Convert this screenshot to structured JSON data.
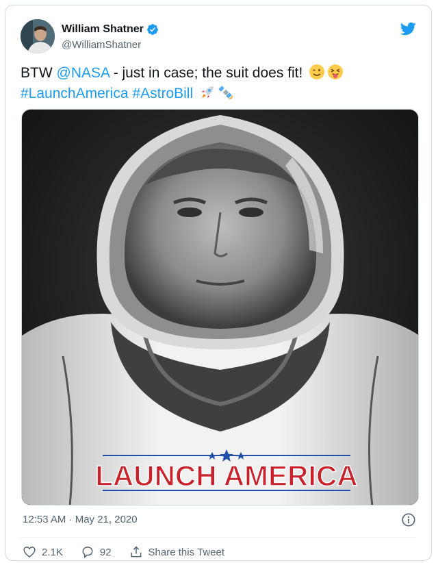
{
  "author": {
    "name": "William Shatner",
    "handle": "@WilliamShatner",
    "verified": true
  },
  "tweet": {
    "prefix": "BTW ",
    "mention": "@NASA",
    "body": " - just in case; the suit does fit!",
    "hashtag1": "#LaunchAmerica",
    "hashtag2": "#AstroBill",
    "emojis": [
      "wink-face-icon",
      "tongue-face-icon",
      "rocket-icon",
      "satellite-icon"
    ]
  },
  "media": {
    "banner_text": "LAUNCH AMERICA"
  },
  "meta": {
    "timestamp": "12:53 AM · May 21, 2020"
  },
  "actions": {
    "likes": "2.1K",
    "replies": "92",
    "share_label": "Share this Tweet"
  },
  "colors": {
    "link": "#1d9bf0",
    "verified": "#1d9bf0",
    "banner_red": "#c8232c",
    "banner_blue": "#1f4fa8"
  }
}
